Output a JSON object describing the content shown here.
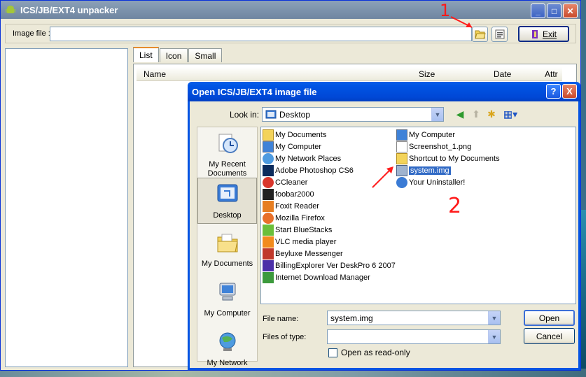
{
  "app": {
    "title": "ICS/JB/EXT4 unpacker",
    "image_file_label": "Image file :",
    "image_file_value": "",
    "exit_label": "Exit",
    "tabs": [
      "List",
      "Icon",
      "Small"
    ],
    "columns": [
      "Name",
      "Size",
      "Date",
      "Attr"
    ]
  },
  "annotations": {
    "one": "1",
    "two": "2"
  },
  "dialog": {
    "title": "Open ICS/JB/EXT4 image file",
    "help": "?",
    "close": "X",
    "look_in_label": "Look in:",
    "look_in_value": "Desktop",
    "places": [
      {
        "label": "My Recent Documents"
      },
      {
        "label": "Desktop"
      },
      {
        "label": "My Documents"
      },
      {
        "label": "My Computer"
      },
      {
        "label": "My Network"
      }
    ],
    "files_left": [
      "My Documents",
      "My Computer",
      "My Network Places",
      "Adobe Photoshop CS6",
      "CCleaner",
      "foobar2000",
      "Foxit Reader",
      "Mozilla Firefox",
      "Start BlueStacks",
      "VLC media player",
      "Beyluxe Messenger",
      "BillingExplorer Ver DeskPro 6 2007",
      "Internet Download Manager"
    ],
    "files_right": [
      "My Computer",
      "Screenshot_1.png",
      "Shortcut to My Documents",
      "system.img",
      "Your Uninstaller!"
    ],
    "selected_file": "system.img",
    "file_name_label": "File name:",
    "file_name_value": "system.img",
    "file_type_label": "Files of type:",
    "file_type_value": "",
    "open_label": "Open",
    "cancel_label": "Cancel",
    "readonly_label": "Open as read-only"
  }
}
